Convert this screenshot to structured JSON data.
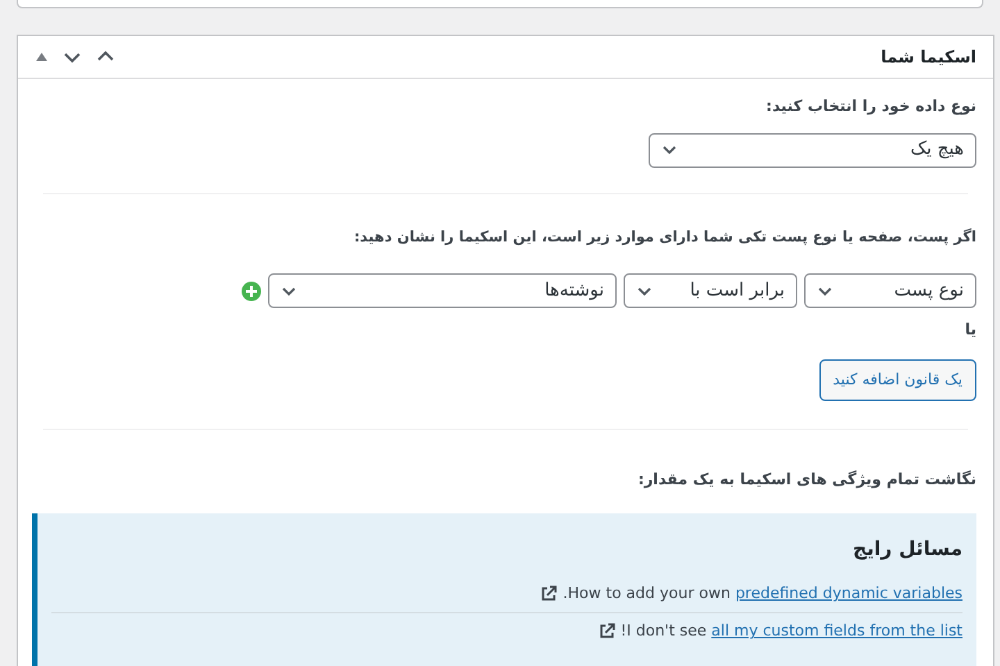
{
  "panel": {
    "title": "اسکیما شما"
  },
  "data_type": {
    "label": "نوع داده خود را انتخاب کنید:",
    "value": "هیچ یک"
  },
  "rules": {
    "label": "اگر پست، صفحه یا نوع پست تکی شما دارای موارد زیر است، این اسکیما را نشان دهید:",
    "row": {
      "param": "نوع پست",
      "operator": "برابر است با",
      "value": "نوشته‌ها"
    },
    "or_label": "یا",
    "add_button": "یک قانون اضافه کنید"
  },
  "mapping": {
    "label": "نگاشت تمام ویژگی های اسکیما به یک مقدار:"
  },
  "notice": {
    "title": "مسائل رایج",
    "items": [
      {
        "before": "How to add your own ",
        "link": "predefined dynamic variables",
        "after": "."
      },
      {
        "before": "I don't see ",
        "link": "all my custom fields from the list",
        "after": "!"
      }
    ]
  }
}
